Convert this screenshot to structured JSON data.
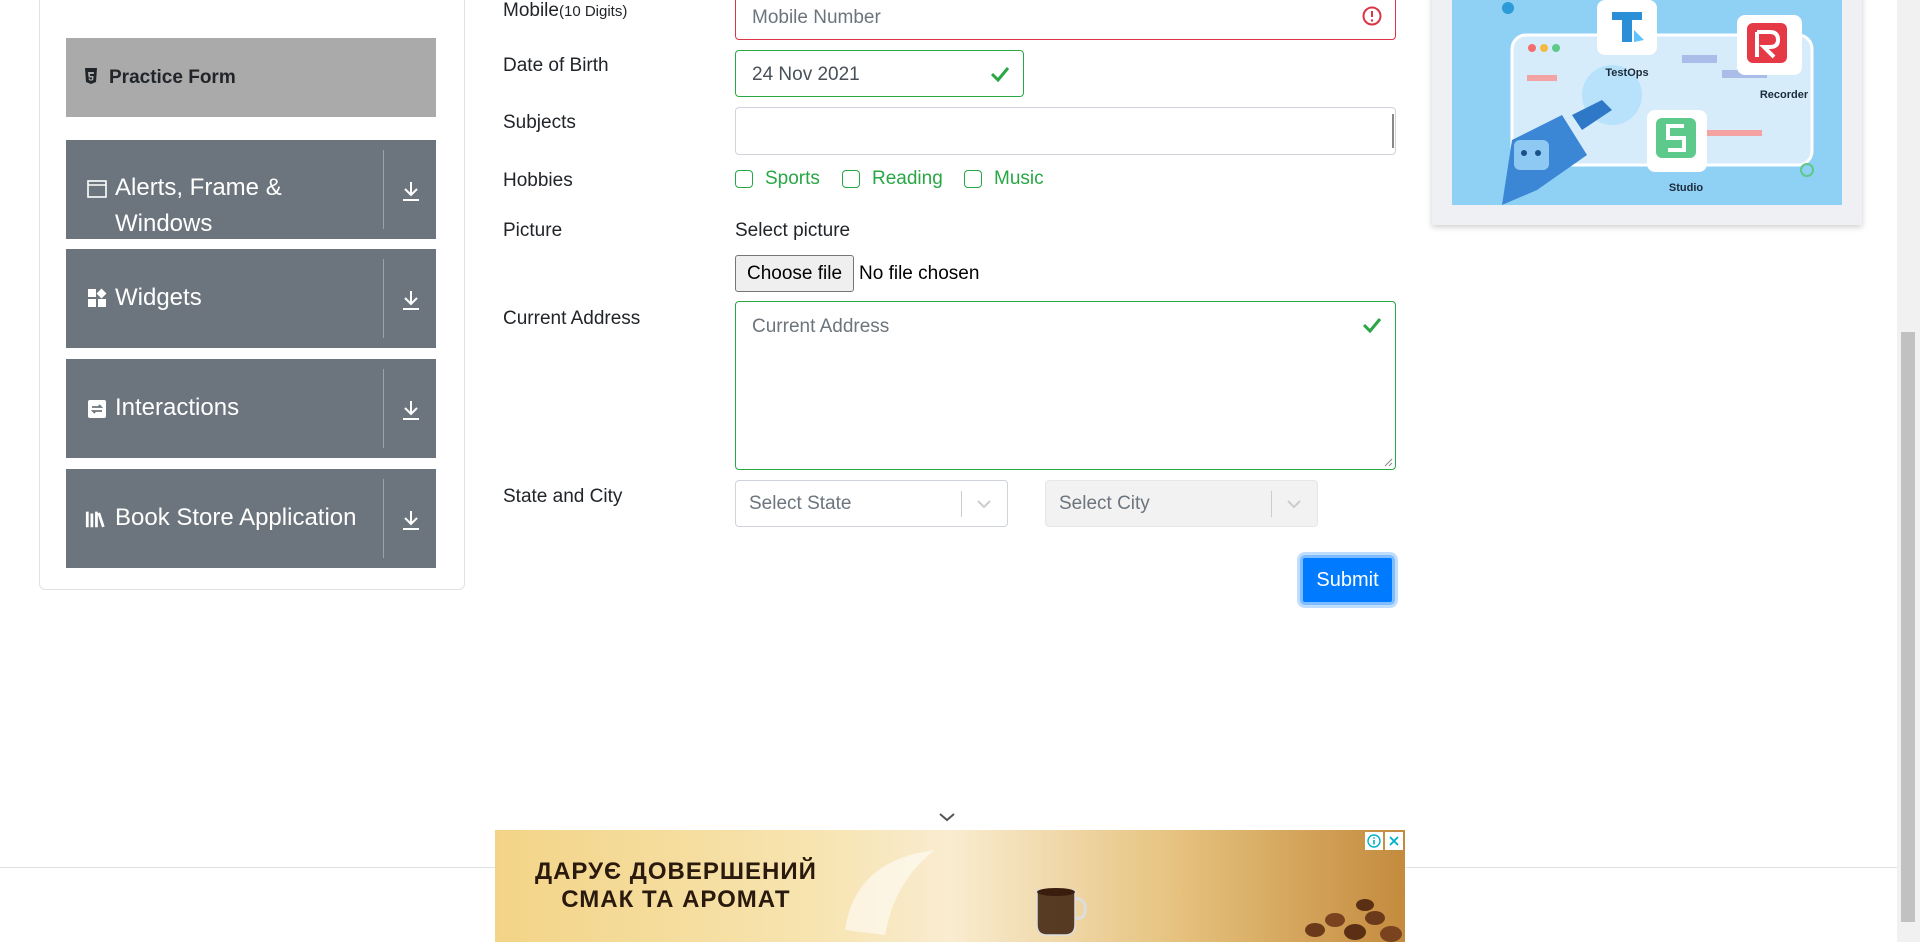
{
  "sidebar": {
    "active_item": {
      "label": "Practice Form",
      "icon": "html5-icon"
    },
    "groups": [
      {
        "label": "Alerts, Frame & Windows",
        "icon": "window-icon",
        "arrow_icon": "download-arrow-icon"
      },
      {
        "label": "Widgets",
        "icon": "widgets-icon",
        "arrow_icon": "download-arrow-icon"
      },
      {
        "label": "Interactions",
        "icon": "interactions-icon",
        "arrow_icon": "download-arrow-icon"
      },
      {
        "label": "Book Store Application",
        "icon": "books-icon",
        "arrow_icon": "download-arrow-icon"
      }
    ]
  },
  "form": {
    "mobile": {
      "label": "Mobile",
      "hint": "(10 Digits)",
      "placeholder": "Mobile Number",
      "status": "invalid"
    },
    "dob": {
      "label": "Date of Birth",
      "value": "24 Nov 2021",
      "status": "valid"
    },
    "subjects": {
      "label": "Subjects",
      "value": ""
    },
    "hobbies": {
      "label": "Hobbies",
      "options": [
        {
          "label": "Sports",
          "checked": false
        },
        {
          "label": "Reading",
          "checked": false
        },
        {
          "label": "Music",
          "checked": false
        }
      ]
    },
    "picture": {
      "label": "Picture",
      "select_label": "Select picture",
      "button_label": "Choose file",
      "status_text": "No file chosen"
    },
    "address": {
      "label": "Current Address",
      "placeholder": "Current Address",
      "status": "valid"
    },
    "state_city": {
      "label": "State and City",
      "state_placeholder": "Select State",
      "city_placeholder": "Select City"
    },
    "submit_label": "Submit"
  },
  "banner": {
    "labels": {
      "testops": "TestOps",
      "recorder": "Recorder",
      "studio": "Studio"
    }
  },
  "ad": {
    "line1": "ДАРУЄ ДОВЕРШЕНИЙ",
    "line2": "СМАК ТА АРОМАТ"
  },
  "colors": {
    "sidebar_group": "#6c757d",
    "sidebar_active": "#aaaaaa",
    "valid": "#28a745",
    "invalid": "#dc3545",
    "primary": "#007bff"
  }
}
